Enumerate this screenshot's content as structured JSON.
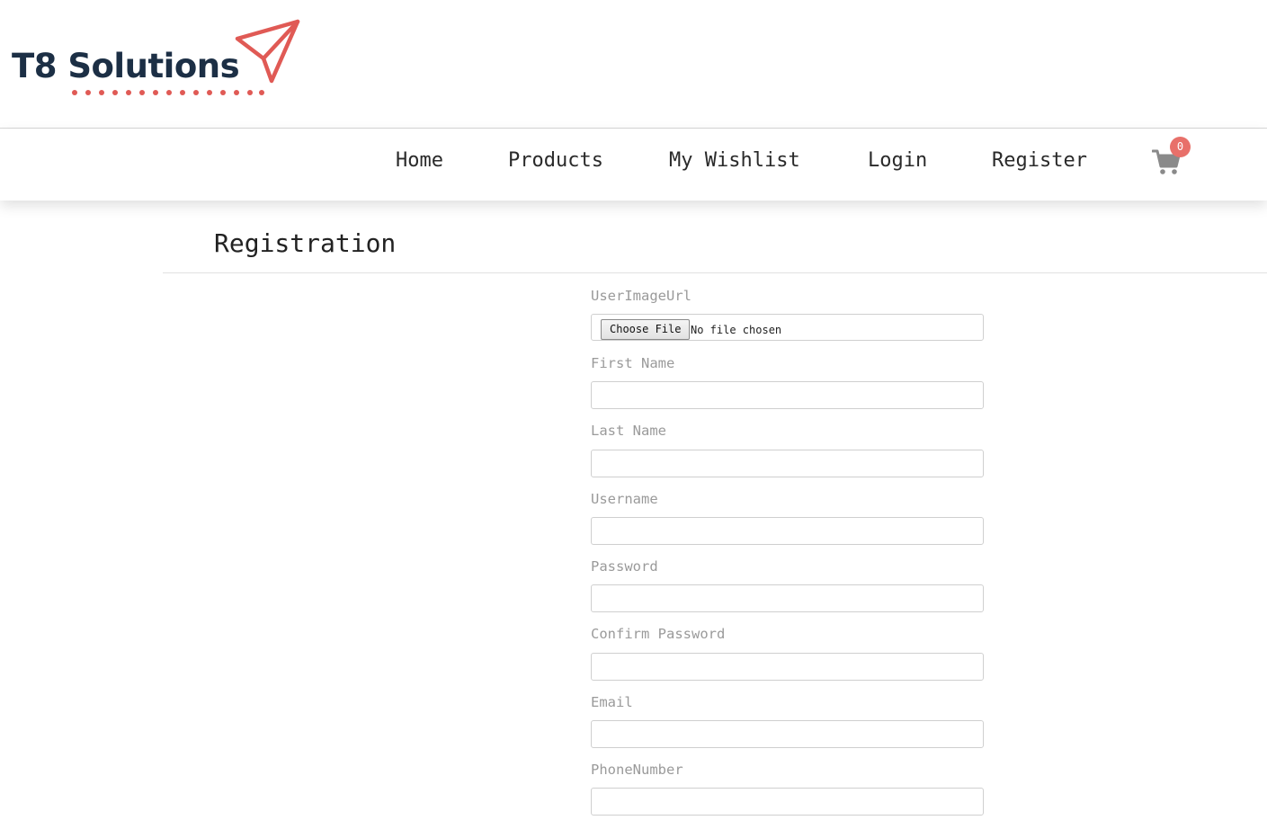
{
  "brand": {
    "name": "T8 Solutions",
    "accent_color": "#e05a55",
    "text_color": "#1c2f45"
  },
  "nav": {
    "items": [
      {
        "label": "Home"
      },
      {
        "label": "Products"
      },
      {
        "label": "My Wishlist"
      },
      {
        "label": "Login"
      },
      {
        "label": "Register"
      }
    ],
    "cart": {
      "icon": "shopping-cart-icon",
      "count": "0",
      "badge_color": "#e8706a"
    }
  },
  "page": {
    "title": "Registration"
  },
  "form": {
    "image": {
      "label": "UserImageUrl",
      "button_label": "Choose File",
      "status": "No file chosen"
    },
    "first_name": {
      "label": "First Name",
      "value": ""
    },
    "last_name": {
      "label": "Last Name",
      "value": ""
    },
    "username": {
      "label": "Username",
      "value": ""
    },
    "password": {
      "label": "Password",
      "value": ""
    },
    "confirm_password": {
      "label": "Confirm Password",
      "value": ""
    },
    "email": {
      "label": "Email",
      "value": ""
    },
    "phone_number": {
      "label": "PhoneNumber",
      "value": ""
    }
  }
}
